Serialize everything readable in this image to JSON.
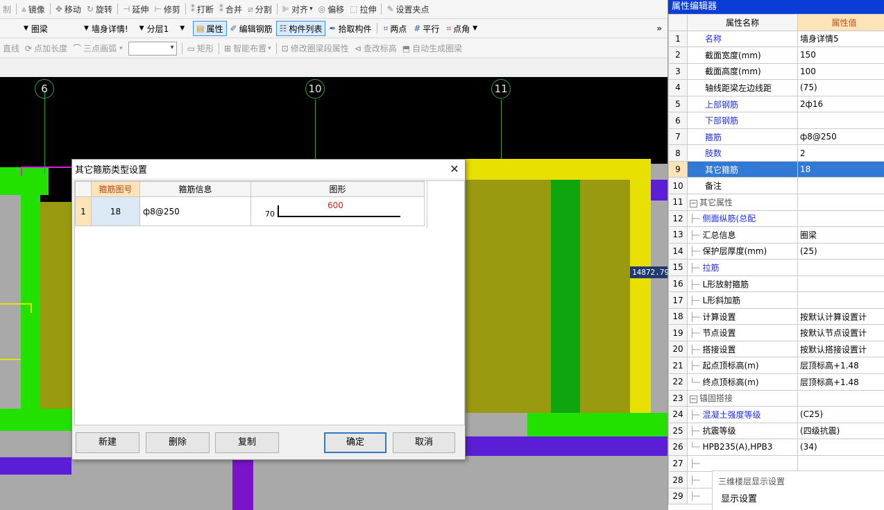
{
  "toolbar1": {
    "items": [
      "制",
      "镜像",
      "移动",
      "旋转",
      "延伸",
      "修剪",
      "打断",
      "合并",
      "分割",
      "对齐",
      "偏移",
      "拉伸",
      "设置夹点"
    ]
  },
  "toolbar2": {
    "combo_type": "圈梁",
    "combo_name": "墙身详情!",
    "combo_layer": "分层1",
    "btn_property": "属性",
    "btn_edit_rebar": "编辑钢筋",
    "btn_component_list": "构件列表",
    "btn_pick": "拾取构件",
    "btn_two_points": "两点",
    "btn_parallel": "平行",
    "btn_point_angle": "点角",
    "overflow": "»"
  },
  "toolbar3": {
    "line": "直线",
    "point_length": "点加长度",
    "three_point_arc": "三点画弧",
    "rect": "矩形",
    "smart_layout": "智能布置",
    "modify_segment": "修改圈梁段属性",
    "check_elevation": "查改标高",
    "auto_generate": "自动生成圈梁"
  },
  "canvas": {
    "axis_labels": [
      "6",
      "10",
      "11"
    ],
    "dimension": "14872.79"
  },
  "dialog": {
    "title": "其它箍筋类型设置",
    "close": "✕",
    "headers": [
      "箍筋图号",
      "箍筋信息",
      "图形"
    ],
    "rows": [
      {
        "index": "1",
        "code": "18",
        "info": "ф8@250",
        "shape_left": "70",
        "shape_length": "600"
      }
    ],
    "buttons": {
      "new": "新建",
      "delete": "删除",
      "copy": "复制",
      "ok": "确定",
      "cancel": "取消"
    }
  },
  "properties": {
    "title": "属性编辑器",
    "header_name": "属性名称",
    "header_value": "属性值",
    "rows": [
      {
        "n": "1",
        "name": "名称",
        "value": "墙身详情5"
      },
      {
        "n": "2",
        "name": "截面宽度(mm)",
        "value": "150"
      },
      {
        "n": "3",
        "name": "截面高度(mm)",
        "value": "100"
      },
      {
        "n": "4",
        "name": "轴线距梁左边线距",
        "value": "(75)"
      },
      {
        "n": "5",
        "name": "上部钢筋",
        "value": "2ф16"
      },
      {
        "n": "6",
        "name": "下部钢筋",
        "value": ""
      },
      {
        "n": "7",
        "name": "箍筋",
        "value": "ф8@250"
      },
      {
        "n": "8",
        "name": "肢数",
        "value": "2"
      },
      {
        "n": "9",
        "name": "其它箍筋",
        "value": "18"
      },
      {
        "n": "10",
        "name": "备注",
        "value": ""
      },
      {
        "n": "11",
        "name": "其它属性",
        "value": ""
      },
      {
        "n": "12",
        "name": "侧面纵筋(总配",
        "value": ""
      },
      {
        "n": "13",
        "name": "汇总信息",
        "value": "圈梁"
      },
      {
        "n": "14",
        "name": "保护层厚度(mm)",
        "value": "(25)"
      },
      {
        "n": "15",
        "name": "拉筋",
        "value": ""
      },
      {
        "n": "16",
        "name": "L形放射箍筋",
        "value": ""
      },
      {
        "n": "17",
        "name": "L形斜加筋",
        "value": ""
      },
      {
        "n": "18",
        "name": "计算设置",
        "value": "按默认计算设置计"
      },
      {
        "n": "19",
        "name": "节点设置",
        "value": "按默认节点设置计"
      },
      {
        "n": "20",
        "name": "搭接设置",
        "value": "按默认搭接设置计"
      },
      {
        "n": "21",
        "name": "起点顶标高(m)",
        "value": "层顶标高+1.48"
      },
      {
        "n": "22",
        "name": "终点顶标高(m)",
        "value": "层顶标高+1.48"
      },
      {
        "n": "23",
        "name": "锚固搭接",
        "value": ""
      },
      {
        "n": "24",
        "name": "混凝土强度等级",
        "value": "(C25)"
      },
      {
        "n": "25",
        "name": "抗震等级",
        "value": "(四级抗震)"
      },
      {
        "n": "26",
        "name": "HPB235(A),HPB3",
        "value": "(34)"
      },
      {
        "n": "27",
        "name": "",
        "value": ""
      },
      {
        "n": "28",
        "name": "",
        "value": ""
      },
      {
        "n": "29",
        "name": "",
        "value": ""
      }
    ],
    "overlay_title": "三维楼层显示设置",
    "overlay_sub": "显示设置"
  }
}
